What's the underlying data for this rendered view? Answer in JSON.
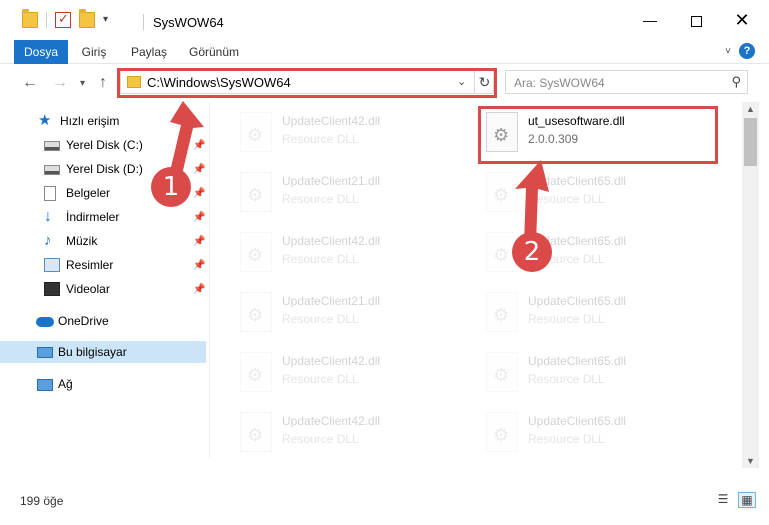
{
  "window": {
    "title": "SysWOW64",
    "minimize": "—",
    "close": "✕"
  },
  "ribbon": {
    "tabs": [
      "Dosya",
      "Giriş",
      "Paylaş",
      "Görünüm"
    ],
    "help": "?"
  },
  "navigation": {
    "back": "←",
    "forward": "→",
    "up": "↑",
    "address": "C:\\Windows\\SysWOW64",
    "refresh": "↻",
    "search_placeholder": "Ara: SysWOW64"
  },
  "sidebar": {
    "items": [
      {
        "label": "Hızlı erişim",
        "icon": "quick-access-icon",
        "pinned": false
      },
      {
        "label": "Yerel Disk (C:)",
        "icon": "drive-icon",
        "pinned": true
      },
      {
        "label": "Yerel Disk (D:)",
        "icon": "drive-icon",
        "pinned": true
      },
      {
        "label": "Belgeler",
        "icon": "documents-icon",
        "pinned": true
      },
      {
        "label": "İndirmeler",
        "icon": "downloads-icon",
        "pinned": true
      },
      {
        "label": "Müzik",
        "icon": "music-icon",
        "pinned": true
      },
      {
        "label": "Resimler",
        "icon": "pictures-icon",
        "pinned": true
      },
      {
        "label": "Videolar",
        "icon": "videos-icon",
        "pinned": true
      },
      {
        "label": "OneDrive",
        "icon": "onedrive-icon",
        "pinned": false
      },
      {
        "label": "Bu bilgisayar",
        "icon": "this-pc-icon",
        "pinned": false,
        "selected": true
      },
      {
        "label": "Ağ",
        "icon": "network-icon",
        "pinned": false
      }
    ]
  },
  "files": [
    {
      "name": "UpdateClient42.dll",
      "desc": "Resource DLL",
      "faded": true
    },
    {
      "name": "ut_usesoftware.dll",
      "desc": "2.0.0.309",
      "faded": false,
      "highlighted": true
    },
    {
      "name": "UpdateClient21.dll",
      "desc": "Resource DLL",
      "faded": true
    },
    {
      "name": "UpdateClient65.dll",
      "desc": "Resource DLL",
      "faded": true
    },
    {
      "name": "UpdateClient42.dll",
      "desc": "Resource DLL",
      "faded": true
    },
    {
      "name": "UpdateClient65.dll",
      "desc": "Resource DLL",
      "faded": true
    },
    {
      "name": "UpdateClient21.dll",
      "desc": "Resource DLL",
      "faded": true
    },
    {
      "name": "UpdateClient65.dll",
      "desc": "Resource DLL",
      "faded": true
    },
    {
      "name": "UpdateClient42.dll",
      "desc": "Resource DLL",
      "faded": true
    },
    {
      "name": "UpdateClient65.dll",
      "desc": "Resource DLL",
      "faded": true
    },
    {
      "name": "UpdateClient42.dll",
      "desc": "Resource DLL",
      "faded": true
    },
    {
      "name": "UpdateClient65.dll",
      "desc": "Resource DLL",
      "faded": true
    }
  ],
  "status": {
    "count": "199 öğe"
  },
  "annotations": {
    "step1": "1",
    "step2": "2",
    "color": "#d94a48"
  }
}
